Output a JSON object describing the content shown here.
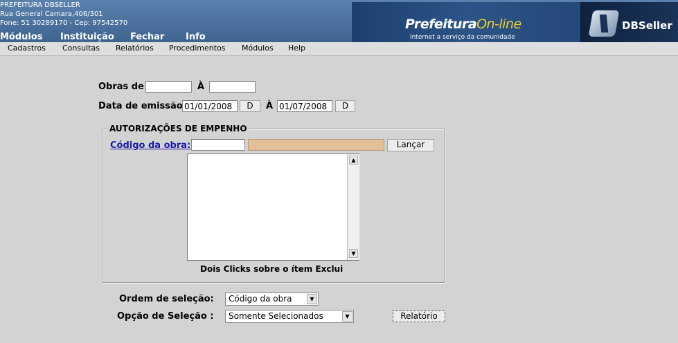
{
  "header": {
    "org_name": "PREFEITURA DBSELLER",
    "address": "Rua General Camara,406/301",
    "contact": "Fone: 51 30289170  -  Cep: 97542570",
    "top_menu": [
      "Módulos",
      "Instituição",
      "Fechar",
      "Info"
    ],
    "banner_logo_prefix": "Prefeitura",
    "banner_logo_suffix": "On-line",
    "banner_tagline": "Internet a serviço da comunidade",
    "company_logo": "DBSeller"
  },
  "menubar": [
    "Cadastros",
    "Consultas",
    "Relatórios",
    "Procedimentos",
    "Módulos",
    "Help"
  ],
  "form": {
    "obras_label": "Obras de",
    "a_label": "À",
    "obras_de_value": "",
    "obras_ate_value": "",
    "data_label": "Data de emissão",
    "data_inicio": "01/01/2008",
    "data_fim": "01/07/2008",
    "d_button": "D",
    "fieldset_legend": "AUTORIZAÇÕES DE EMPENHO",
    "codigo_label": "Código da obra:",
    "codigo_value": "",
    "descricao_value": "",
    "lancar_button": "Lançar",
    "list_hint": "Dois Clicks sobre o ítem Exclui",
    "ordem_label": "Ordem de seleção:",
    "ordem_selected": "Código da obra",
    "opcao_label": "Opção de Seleção :",
    "opcao_selected": "Somente Selecionados",
    "relatorio_button": "Relatório"
  },
  "colors": {
    "header_blue": "#4a6f9c",
    "background": "#d3d3d3",
    "description_field": "#e2bf96",
    "link": "#1a1aa6"
  }
}
